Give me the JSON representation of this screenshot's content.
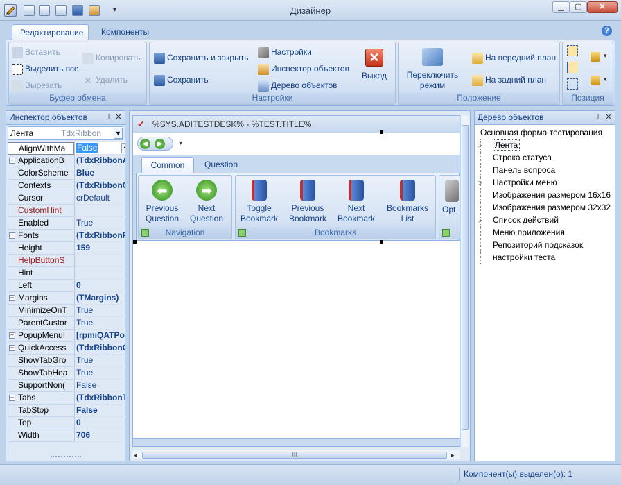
{
  "window": {
    "title": "Дизайнер"
  },
  "colors": {
    "accent": "#15428b",
    "ribbon_bg": "#dfe9f5",
    "selected": "#3399ff",
    "error_red": "#d03a2a"
  },
  "icons": {
    "qat": [
      "designer-icon",
      "new-icon",
      "cut-icon",
      "copy-icon",
      "save-icon",
      "edit-icon"
    ]
  },
  "ribbon": {
    "tabs": [
      "Редактирование",
      "Компоненты"
    ],
    "clipboard": {
      "label": "Буфер обмена",
      "paste": "Вставить",
      "select_all": "Выделить все",
      "cut": "Вырезать",
      "copy": "Копировать",
      "delete": "Удалить"
    },
    "settings": {
      "label": "Настройки",
      "save_close": "Сохранить и закрыть",
      "save": "Сохранить",
      "settings": "Настройки",
      "inspector": "Инспектор объектов",
      "tree": "Дерево объектов",
      "exit": "Выход"
    },
    "position": {
      "label": "Положение",
      "switch_mode": "Переключить режим",
      "front": "На передний план",
      "back": "На задний план"
    },
    "pos": {
      "label": "Позиция"
    }
  },
  "inspector": {
    "title": "Инспектор объектов",
    "object_name": "Лента",
    "object_type": "TdxRibbon",
    "properties": [
      {
        "n": "AlignWithMa",
        "v": "False",
        "sel": true
      },
      {
        "n": "ApplicationB",
        "v": "(TdxRibbonApp",
        "exp": true,
        "b": true
      },
      {
        "n": "ColorScheme",
        "v": "Blue",
        "b": true
      },
      {
        "n": "Contexts",
        "v": "(TdxRibbonCon",
        "b": true
      },
      {
        "n": "Cursor",
        "v": "crDefault"
      },
      {
        "n": "CustomHint",
        "v": "",
        "red": true
      },
      {
        "n": "Enabled",
        "v": "True"
      },
      {
        "n": "Fonts",
        "v": "(TdxRibbonFon",
        "exp": true,
        "b": true
      },
      {
        "n": "Height",
        "v": "159",
        "b": true
      },
      {
        "n": "HelpButtonS",
        "v": "",
        "red": true
      },
      {
        "n": "Hint",
        "v": ""
      },
      {
        "n": "Left",
        "v": "0",
        "b": true
      },
      {
        "n": "Margins",
        "v": "(TMargins)",
        "exp": true,
        "b": true
      },
      {
        "n": "MinimizeOnT",
        "v": "True"
      },
      {
        "n": "ParentCustor",
        "v": "True"
      },
      {
        "n": "PopupMenuI",
        "v": "[rpmiQATPosit",
        "exp": true,
        "b": true
      },
      {
        "n": "QuickAccess",
        "v": "(TdxRibbonQu",
        "exp": true,
        "b": true
      },
      {
        "n": "ShowTabGro",
        "v": "True"
      },
      {
        "n": "ShowTabHea",
        "v": "True"
      },
      {
        "n": "SupportNon(",
        "v": "False"
      },
      {
        "n": "Tabs",
        "v": "(TdxRibbonTab",
        "exp": true,
        "b": true
      },
      {
        "n": "TabStop",
        "v": "False",
        "b": true
      },
      {
        "n": "Top",
        "v": "0",
        "b": true
      },
      {
        "n": "Width",
        "v": "706",
        "b": true
      }
    ]
  },
  "form": {
    "title": "%SYS.ADITESTDESK% - %TEST.TITLE%",
    "tabs": [
      "Common",
      "Question"
    ],
    "nav_group": "Navigation",
    "bm_group": "Bookmarks",
    "buttons": [
      {
        "l1": "Previous",
        "l2": "Question",
        "icon": "arrow-left-icon"
      },
      {
        "l1": "Next",
        "l2": "Question",
        "icon": "arrow-right-icon"
      },
      {
        "l1": "Toggle",
        "l2": "Bookmark",
        "icon": "bookmark-add-icon"
      },
      {
        "l1": "Previous",
        "l2": "Bookmark",
        "icon": "bookmark-prev-icon"
      },
      {
        "l1": "Next",
        "l2": "Bookmark",
        "icon": "bookmark-next-icon"
      },
      {
        "l1": "Bookmarks",
        "l2": "List",
        "icon": "bookmark-list-icon"
      },
      {
        "l1": "Opt",
        "l2": "",
        "icon": "tools-icon"
      }
    ],
    "scroll_mark": "III"
  },
  "tree": {
    "title": "Дерево объектов",
    "items": [
      {
        "t": "Основная форма тестирования",
        "lvl": 0
      },
      {
        "t": "Лента",
        "lvl": 1,
        "sel": true,
        "exp": true
      },
      {
        "t": "Строка статуса",
        "lvl": 1
      },
      {
        "t": "Панель вопроса",
        "lvl": 1
      },
      {
        "t": "Настройки меню",
        "lvl": 1,
        "exp": true
      },
      {
        "t": "Изображения размером 16x16",
        "lvl": 1
      },
      {
        "t": "Изображения размером 32x32",
        "lvl": 1
      },
      {
        "t": "Список действий",
        "lvl": 1,
        "exp": true
      },
      {
        "t": "Меню приложения",
        "lvl": 1
      },
      {
        "t": "Репозиторий подсказок",
        "lvl": 1
      },
      {
        "t": "настройки теста",
        "lvl": 1
      }
    ]
  },
  "status": {
    "text": "Компонент(ы) выделен(о): 1"
  }
}
